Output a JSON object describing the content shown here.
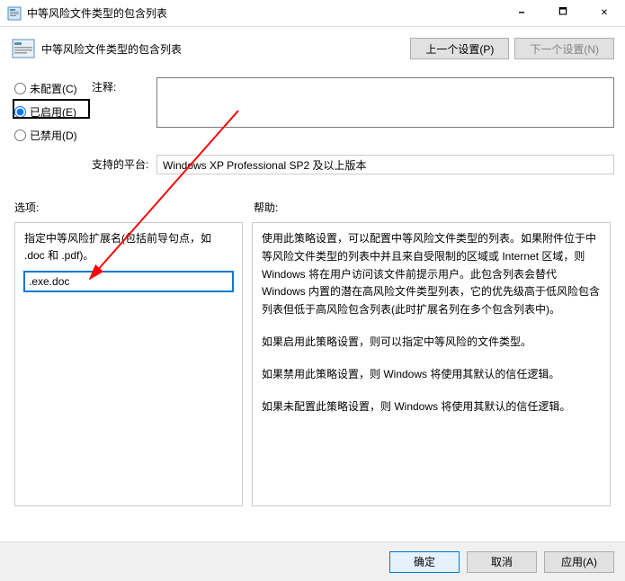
{
  "titlebar": {
    "title": "中等风险文件类型的包含列表"
  },
  "header": {
    "title": "中等风险文件类型的包含列表",
    "prev_btn": "上一个设置(P)",
    "next_btn": "下一个设置(N)"
  },
  "radios": {
    "not_configured": "未配置(C)",
    "enabled": "已启用(E)",
    "disabled": "已禁用(D)"
  },
  "labels": {
    "comment": "注释:",
    "platform": "支持的平台:",
    "options": "选项:",
    "help": "帮助:"
  },
  "platform_text": "Windows XP Professional SP2 及以上版本",
  "options_panel": {
    "desc": "指定中等风险扩展名(包括前导句点，如 .doc 和 .pdf)。",
    "input_value": ".exe.doc"
  },
  "help_panel": {
    "p1": "使用此策略设置，可以配置中等风险文件类型的列表。如果附件位于中等风险文件类型的列表中并且来自受限制的区域或 Internet 区域，则 Windows 将在用户访问该文件前提示用户。此包含列表会替代 Windows 内置的潜在高风险文件类型列表，它的优先级高于低风险包含列表但低于高风险包含列表(此时扩展名列在多个包含列表中)。",
    "p2": "如果启用此策略设置，则可以指定中等风险的文件类型。",
    "p3": "如果禁用此策略设置，则 Windows 将使用其默认的信任逻辑。",
    "p4": "如果未配置此策略设置，则 Windows 将使用其默认的信任逻辑。"
  },
  "footer": {
    "ok": "确定",
    "cancel": "取消",
    "apply": "应用(A)"
  }
}
